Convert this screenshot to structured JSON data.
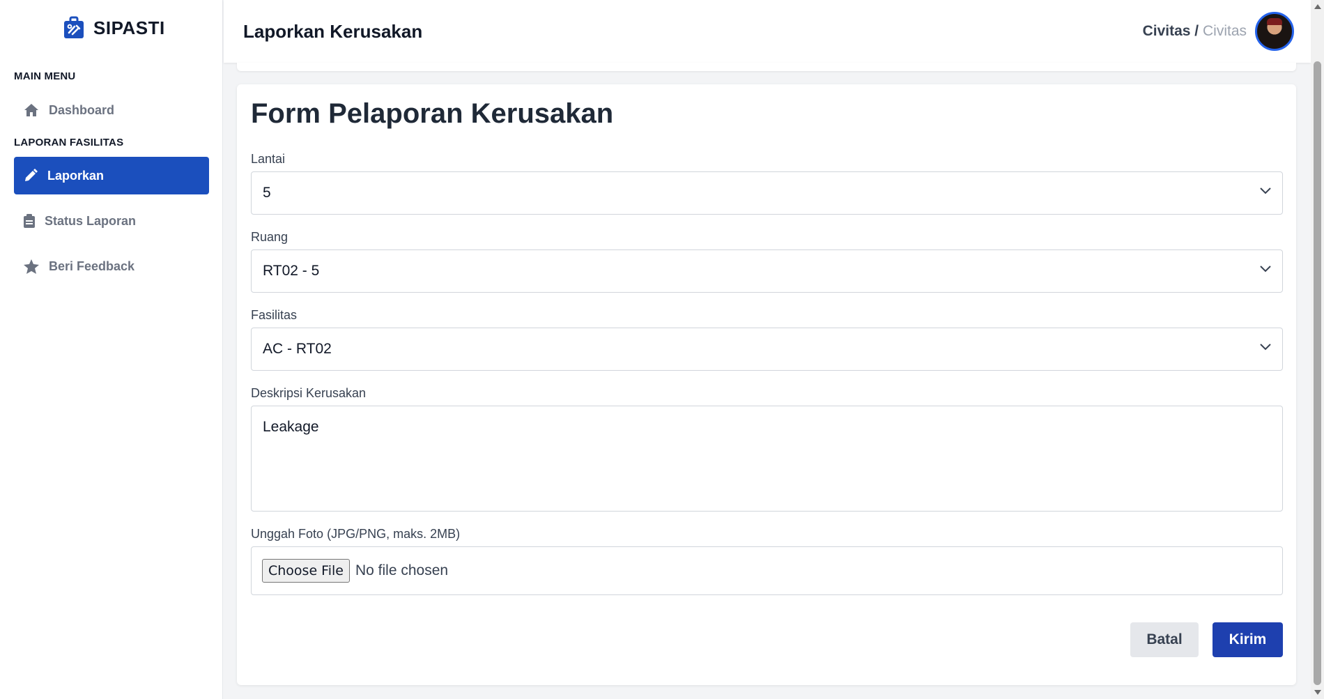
{
  "app": {
    "name": "SIPASTI"
  },
  "sidebar": {
    "sections": [
      {
        "label": "MAIN MENU"
      },
      {
        "label": "LAPORAN FASILITAS"
      }
    ],
    "items": [
      {
        "label": "Dashboard",
        "icon": "home-icon"
      },
      {
        "label": "Laporkan",
        "icon": "pencil-icon",
        "active": true
      },
      {
        "label": "Status Laporan",
        "icon": "clipboard-icon"
      },
      {
        "label": "Beri Feedback",
        "icon": "star-icon"
      }
    ]
  },
  "header": {
    "title": "Laporkan Kerusakan",
    "role_primary": "Civitas",
    "role_separator": " / ",
    "role_secondary": "Civitas"
  },
  "form": {
    "title": "Form Pelaporan Kerusakan",
    "lantai": {
      "label": "Lantai",
      "value": "5"
    },
    "ruang": {
      "label": "Ruang",
      "value": "RT02 - 5"
    },
    "fasilitas": {
      "label": "Fasilitas",
      "value": "AC - RT02"
    },
    "deskripsi": {
      "label": "Deskripsi Kerusakan",
      "value": "Leakage"
    },
    "foto": {
      "label": "Unggah Foto (JPG/PNG, maks. 2MB)",
      "button": "Choose File",
      "status": "No file chosen"
    },
    "cancel_label": "Batal",
    "submit_label": "Kirim"
  },
  "colors": {
    "primary": "#1b4fbd",
    "submit": "#1e40af",
    "cancel_bg": "#e5e7eb"
  }
}
